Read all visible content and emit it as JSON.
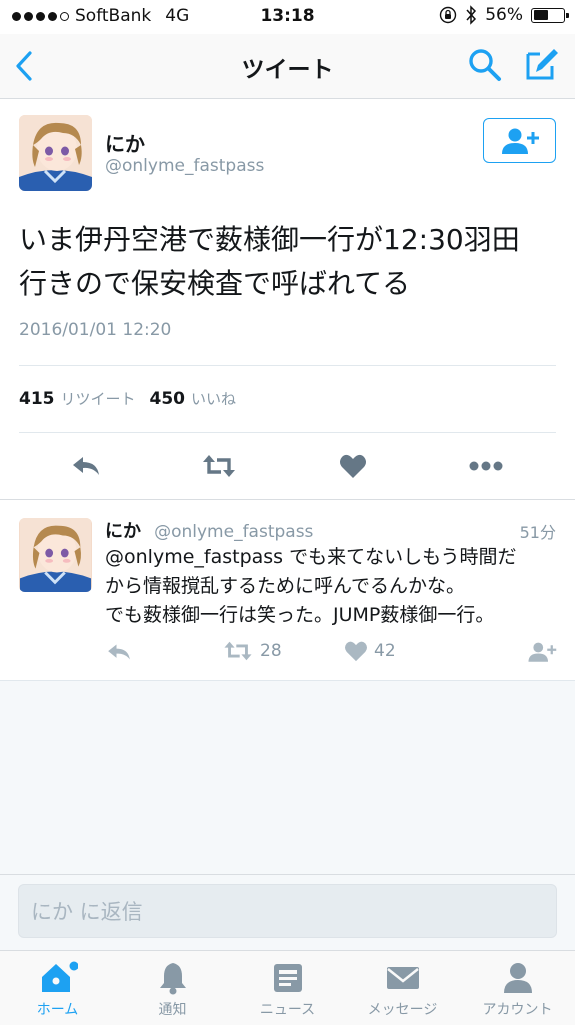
{
  "status_bar": {
    "carrier": "SoftBank",
    "network": "4G",
    "time": "13:18",
    "battery": "56%",
    "battery_level": 0.56,
    "signal_bars": 4,
    "signal_total": 5
  },
  "nav": {
    "title": "ツイート",
    "back_icon": "chevron-left-icon",
    "search_icon": "search-icon",
    "compose_icon": "compose-icon"
  },
  "tweet": {
    "author_name": "にか",
    "author_handle": "@onlyme_fastpass",
    "text_line1": "いま伊丹空港で薮様御一行が12:30羽田",
    "text_line2": "行きので保安検査で呼ばれてる",
    "timestamp": "2016/01/01 12:20",
    "retweet_count": "415",
    "retweet_label": "リツイート",
    "like_count": "450",
    "like_label": "いいね"
  },
  "reply": {
    "author_name": "にか",
    "author_handle": "@onlyme_fastpass",
    "age": "51分",
    "text_line1": "@onlyme_fastpass でも来てないしもう時間だ",
    "text_line2": "から情報撹乱するために呼んでるんかな。",
    "text_line3": "でも薮様御一行は笑った。JUMP薮様御一行。",
    "retweet_count": "28",
    "like_count": "42"
  },
  "composer": {
    "placeholder": "にか に返信"
  },
  "tabbar": {
    "items": [
      {
        "label": "ホーム",
        "icon": "home-icon",
        "active": true
      },
      {
        "label": "通知",
        "icon": "bell-icon",
        "active": false
      },
      {
        "label": "ニュース",
        "icon": "news-icon",
        "active": false
      },
      {
        "label": "メッセージ",
        "icon": "envelope-icon",
        "active": false
      },
      {
        "label": "アカウント",
        "icon": "person-icon",
        "active": false
      }
    ]
  },
  "colors": {
    "accent": "#1da1f2",
    "muted": "#8899a6",
    "action_gray": "#657786",
    "text": "#14171a"
  }
}
